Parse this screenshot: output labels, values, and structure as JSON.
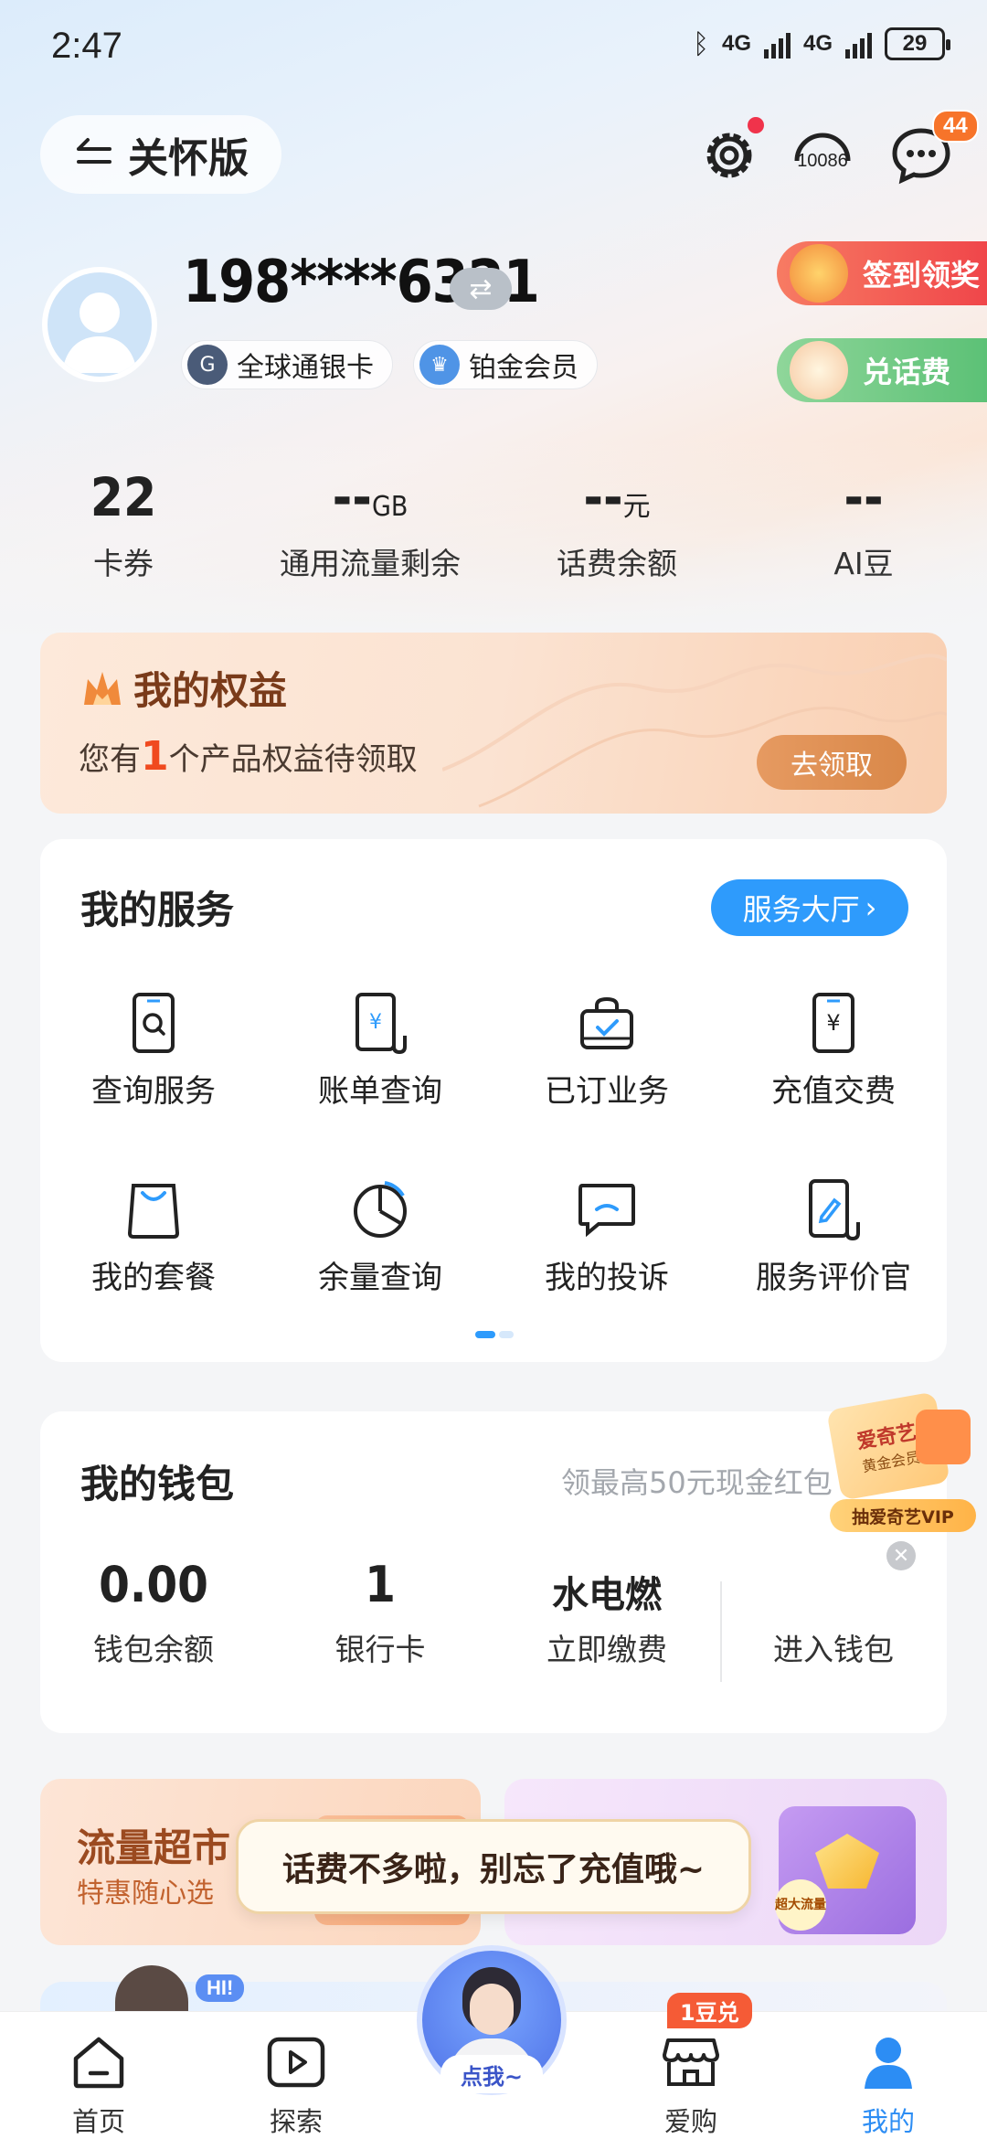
{
  "status_bar": {
    "time": "2:47",
    "signal1": "4G",
    "signal2": "4G",
    "battery": "29"
  },
  "header": {
    "care_mode_label": "关怀版",
    "hotline_label": "10086",
    "message_badge": "44"
  },
  "profile": {
    "phone": "198****6321",
    "tags": [
      "全球通银卡",
      "铂金会员"
    ],
    "signin_label": "签到领奖",
    "exchange_label": "兑话费"
  },
  "stats": [
    {
      "value": "22",
      "unit": "",
      "label": "卡券"
    },
    {
      "value": "--",
      "unit": "GB",
      "label": "通用流量剩余"
    },
    {
      "value": "--",
      "unit": "元",
      "label": "话费余额"
    },
    {
      "value": "--",
      "unit": "",
      "label": "AI豆"
    }
  ],
  "rights": {
    "title": "我的权益",
    "sub_prefix": "您有",
    "count": "1",
    "sub_suffix": "个产品权益待领取",
    "button": "去领取"
  },
  "services": {
    "title": "我的服务",
    "hall_label": "服务大厅",
    "items": [
      {
        "label": "查询服务",
        "icon": "phone-search-icon"
      },
      {
        "label": "账单查询",
        "icon": "bill-icon"
      },
      {
        "label": "已订业务",
        "icon": "subscribed-bag-icon"
      },
      {
        "label": "充值交费",
        "icon": "recharge-icon"
      },
      {
        "label": "我的套餐",
        "icon": "package-bag-icon"
      },
      {
        "label": "余量查询",
        "icon": "pie-chart-icon"
      },
      {
        "label": "我的投诉",
        "icon": "complaint-chat-icon"
      },
      {
        "label": "服务评价官",
        "icon": "evaluate-pen-icon"
      }
    ]
  },
  "wallet": {
    "title": "我的钱包",
    "promo": "领最高50元现金红包",
    "items": [
      {
        "value": "0.00",
        "label": "钱包余额"
      },
      {
        "value": "1",
        "label": "银行卡"
      },
      {
        "value": "水电燃",
        "label": "立即缴费"
      },
      {
        "value": "",
        "label": "进入钱包"
      }
    ],
    "float_badge": {
      "line1": "爱奇艺",
      "line2": "黄金会员",
      "line3": "抽爱奇艺VIP"
    }
  },
  "promos": {
    "left_title": "流量超市",
    "left_sub": "特惠随心选",
    "right_badge": "超大流量",
    "tooltip": "话费不多啦，别忘了充值哦~"
  },
  "assistant": {
    "label": "点我~",
    "hi": "HI!"
  },
  "tabbar": {
    "tabs": [
      {
        "label": "首页",
        "icon": "home-icon"
      },
      {
        "label": "探索",
        "icon": "play-icon"
      },
      {
        "label": "爱购",
        "icon": "shop-icon"
      },
      {
        "label": "我的",
        "icon": "user-icon"
      }
    ],
    "shop_badge": "1豆兑",
    "active": "我的"
  },
  "colors": {
    "accent": "#2e9bfc",
    "active_tab": "#2c8df4",
    "rights_text": "#7a3b1a",
    "signin_red": "#f0464a",
    "exchange_green": "#5cc176"
  }
}
